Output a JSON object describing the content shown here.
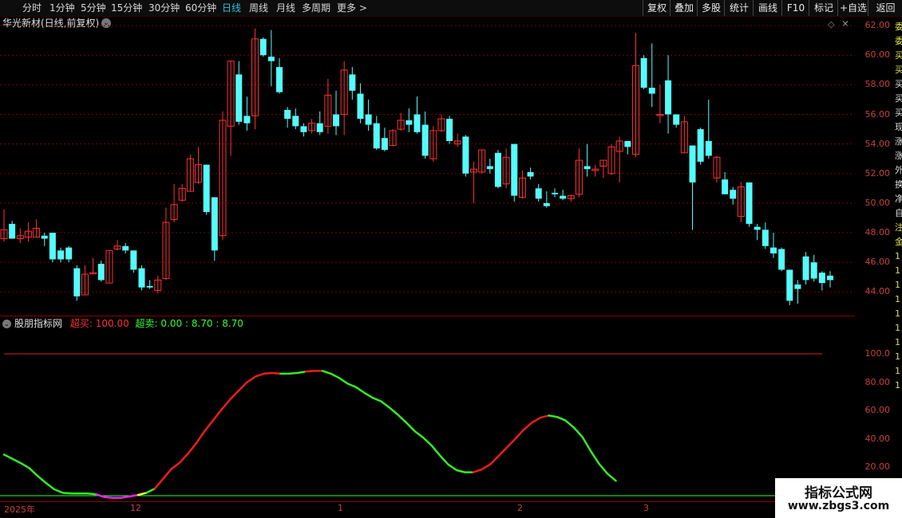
{
  "toolbar": {
    "periods": [
      "分时",
      "1分钟",
      "5分钟",
      "15分钟",
      "30分钟",
      "60分钟",
      "日线",
      "周线",
      "月线",
      "多周期",
      "更多 >"
    ],
    "active_period": "日线",
    "right_buttons": [
      "复权",
      "叠加",
      "多股",
      "统计",
      "画线",
      "F10",
      "标记",
      "+自选",
      "返回"
    ]
  },
  "stock": {
    "title": "华光新材(日线,前复权)"
  },
  "price_axis": {
    "ticks": [
      "62.00",
      "60.00",
      "58.00",
      "56.00",
      "54.00",
      "52.00",
      "50.00",
      "48.00",
      "46.00",
      "44.00"
    ],
    "min": 42.4,
    "max": 62.6
  },
  "indicator": {
    "name": "股朋指标网",
    "overbought_label": "超买:",
    "overbought_value": "100.00",
    "oversold_label": "超卖:",
    "oversold_values": "0.00 : 8.70 : 8.70",
    "axis_ticks": [
      "100.0",
      "80.00",
      "60.00",
      "40.00",
      "20.00"
    ],
    "line_level": 100,
    "low_line_level": 0
  },
  "date_axis": {
    "labels": [
      "2025年",
      "12",
      "1",
      "2",
      "3"
    ]
  },
  "right_strip": {
    "chars": [
      "委",
      "委",
      "买",
      "买",
      "买",
      "买",
      "买",
      "现",
      "涨",
      "涨",
      "外",
      "换",
      "净",
      "自",
      "注",
      "金",
      "1",
      "1",
      "1",
      "1",
      "1",
      "1",
      "1",
      "1",
      "1",
      "1"
    ]
  },
  "watermark": {
    "line1": "指标公式网",
    "line2": "www.zbgs3.com"
  },
  "colors": {
    "up": "#ff3232",
    "down": "#54fcfc",
    "grid": "#7a0000",
    "red_line": "#e02020",
    "green_line": "#30ff30"
  },
  "chart_data": {
    "type": "candlestick",
    "candles": [
      [
        47.6,
        49.6,
        48.2,
        47.4
      ],
      [
        48.6,
        48.8,
        47.6,
        47.6
      ],
      [
        47.6,
        48.3,
        47.8,
        47.3
      ],
      [
        47.7,
        48.7,
        48.1,
        47.4
      ],
      [
        47.7,
        48.9,
        48.3,
        47.7
      ],
      [
        47.8,
        48.0,
        47.6,
        47.1
      ],
      [
        48.0,
        48.0,
        46.2,
        46.0
      ],
      [
        46.8,
        47.0,
        46.2,
        46.0
      ],
      [
        47.0,
        47.1,
        46.2,
        46.0
      ],
      [
        45.6,
        45.8,
        43.7,
        43.4
      ],
      [
        43.8,
        45.8,
        45.2,
        43.8
      ],
      [
        45.3,
        46.3,
        45.3,
        45.2
      ],
      [
        45.9,
        46.1,
        44.8,
        44.7
      ],
      [
        44.6,
        46.8,
        46.8,
        44.6
      ],
      [
        46.9,
        47.5,
        47.1,
        46.8
      ],
      [
        47.1,
        47.3,
        46.8,
        46.6
      ],
      [
        46.8,
        46.8,
        45.5,
        45.3
      ],
      [
        45.6,
        45.8,
        44.3,
        44.1
      ],
      [
        44.4,
        44.8,
        44.3,
        44.2
      ],
      [
        44.1,
        45.1,
        44.8,
        43.9
      ],
      [
        44.9,
        49.7,
        48.7,
        44.8
      ],
      [
        48.9,
        51.3,
        49.9,
        48.7
      ],
      [
        50.2,
        51.3,
        51.0,
        50.1
      ],
      [
        50.8,
        53.3,
        53.0,
        50.8
      ],
      [
        51.4,
        53.8,
        52.6,
        51.3
      ],
      [
        52.6,
        52.6,
        49.4,
        49.2
      ],
      [
        50.4,
        50.4,
        46.8,
        46.1
      ],
      [
        47.8,
        56.2,
        55.6,
        47.5
      ],
      [
        55.2,
        59.6,
        59.6,
        53.2
      ],
      [
        58.7,
        59.6,
        55.5,
        55.3
      ],
      [
        55.9,
        57.2,
        55.4,
        54.9
      ],
      [
        55.9,
        61.8,
        61.1,
        55.0
      ],
      [
        61.1,
        61.2,
        60.0,
        59.9
      ],
      [
        59.9,
        61.7,
        59.6,
        57.9
      ],
      [
        59.2,
        59.8,
        57.5,
        57.4
      ],
      [
        56.3,
        56.5,
        55.7,
        55.1
      ],
      [
        55.9,
        56.4,
        55.2,
        55.0
      ],
      [
        55.2,
        55.4,
        54.8,
        54.5
      ],
      [
        54.9,
        55.7,
        55.4,
        54.7
      ],
      [
        55.4,
        56.2,
        54.8,
        54.6
      ],
      [
        55.2,
        58.4,
        57.3,
        54.7
      ],
      [
        56.0,
        57.6,
        55.2,
        54.6
      ],
      [
        56.0,
        59.6,
        59.0,
        54.6
      ],
      [
        58.7,
        59.2,
        57.6,
        57.0
      ],
      [
        57.4,
        58.1,
        55.7,
        55.4
      ],
      [
        56.0,
        57.0,
        55.3,
        54.9
      ],
      [
        55.4,
        55.9,
        53.7,
        53.6
      ],
      [
        54.4,
        55.1,
        53.6,
        53.5
      ],
      [
        53.9,
        55.0,
        54.9,
        53.9
      ],
      [
        55.0,
        56.1,
        55.6,
        54.9
      ],
      [
        55.6,
        56.4,
        55.3,
        54.8
      ],
      [
        56.0,
        57.2,
        54.8,
        54.7
      ],
      [
        55.3,
        56.2,
        53.2,
        53.0
      ],
      [
        53.0,
        55.2,
        54.9,
        52.8
      ],
      [
        54.9,
        56.0,
        55.7,
        54.8
      ],
      [
        55.7,
        55.9,
        54.2,
        54.0
      ],
      [
        54.0,
        54.7,
        54.2,
        53.8
      ],
      [
        54.5,
        54.6,
        52.0,
        51.8
      ],
      [
        52.1,
        52.8,
        52.3,
        50.0
      ],
      [
        52.1,
        53.5,
        53.6,
        52.0
      ],
      [
        52.5,
        53.0,
        52.3,
        52.0
      ],
      [
        53.4,
        53.6,
        51.1,
        51.0
      ],
      [
        51.3,
        53.7,
        53.1,
        51.0
      ],
      [
        54.0,
        54.0,
        50.5,
        50.1
      ],
      [
        50.4,
        52.2,
        51.7,
        50.3
      ],
      [
        52.1,
        52.4,
        51.8,
        51.6
      ],
      [
        51.0,
        51.3,
        50.3,
        50.1
      ],
      [
        50.0,
        50.8,
        49.8,
        49.7
      ],
      [
        50.7,
        51.0,
        50.6,
        50.4
      ],
      [
        50.5,
        50.9,
        50.3,
        50.2
      ],
      [
        50.3,
        50.6,
        50.5,
        50.1
      ],
      [
        50.6,
        53.7,
        52.9,
        50.4
      ],
      [
        52.5,
        54.0,
        52.3,
        51.8
      ],
      [
        52.2,
        52.6,
        52.3,
        51.8
      ],
      [
        52.5,
        52.5,
        52.9,
        51.7
      ],
      [
        52.0,
        54.0,
        53.8,
        51.9
      ],
      [
        53.5,
        54.5,
        54.2,
        51.4
      ],
      [
        54.2,
        53.5,
        53.8,
        53.3
      ],
      [
        53.3,
        61.5,
        59.3,
        53.1
      ],
      [
        59.8,
        60.0,
        57.8,
        57.7
      ],
      [
        57.8,
        60.8,
        57.4,
        56.5
      ],
      [
        56.0,
        58.0,
        56.0,
        55.4
      ],
      [
        58.3,
        60.0,
        56.0,
        54.7
      ],
      [
        56.0,
        55.9,
        55.3,
        55.1
      ],
      [
        53.4,
        55.9,
        55.5,
        54.1
      ],
      [
        53.9,
        53.9,
        51.4,
        48.2
      ],
      [
        55.0,
        55.1,
        52.8,
        52.6
      ],
      [
        54.2,
        57.0,
        53.2,
        53.0
      ],
      [
        51.7,
        53.2,
        53.1,
        51.4
      ],
      [
        51.6,
        52.1,
        50.6,
        50.6
      ],
      [
        50.9,
        51.1,
        50.3,
        49.9
      ],
      [
        49.1,
        51.4,
        51.1,
        48.7
      ],
      [
        51.4,
        51.4,
        48.6,
        48.4
      ],
      [
        48.4,
        48.6,
        48.2,
        47.5
      ],
      [
        48.2,
        48.7,
        47.1,
        46.9
      ],
      [
        47.0,
        48.0,
        46.6,
        46.3
      ],
      [
        46.9,
        47.0,
        45.5,
        45.4
      ],
      [
        45.5,
        45.5,
        43.4,
        43.1
      ],
      [
        44.5,
        44.8,
        44.2,
        43.2
      ],
      [
        46.4,
        46.7,
        44.8,
        44.5
      ],
      [
        46.0,
        46.5,
        44.9,
        44.7
      ],
      [
        45.3,
        45.4,
        44.6,
        44.1
      ],
      [
        45.1,
        45.4,
        44.8,
        44.3
      ]
    ],
    "indicator_segments": [
      {
        "color": "green",
        "values": [
          29,
          26,
          23,
          19.5,
          14,
          9,
          4.5,
          2,
          1.5,
          1.5,
          1.5,
          1
        ]
      },
      {
        "color": "magenta",
        "values": [
          1,
          -1,
          -1.5,
          -1.5,
          -0.5,
          0.5
        ]
      },
      {
        "color": "yellow",
        "values": [
          0.5,
          2
        ]
      },
      {
        "color": "green",
        "values": [
          2,
          5
        ]
      },
      {
        "color": "red",
        "values": [
          5,
          12,
          19,
          23.5,
          30,
          37.5,
          46,
          53.5,
          61,
          68,
          74,
          80,
          84,
          86,
          86.5,
          86
        ]
      },
      {
        "color": "green",
        "values": [
          86,
          86,
          86.5,
          87.5
        ]
      },
      {
        "color": "red",
        "values": [
          87.5,
          88,
          88
        ]
      },
      {
        "color": "green",
        "values": [
          88,
          86,
          83,
          79,
          76.5,
          72.5,
          69,
          66.5,
          62,
          57,
          51.5,
          45.5,
          41,
          35.5,
          28.5,
          22,
          18,
          16.5,
          16.5
        ]
      },
      {
        "color": "red",
        "values": [
          16.5,
          18.5,
          22,
          28,
          34,
          40,
          46.5,
          51.5,
          55,
          56.5
        ]
      },
      {
        "color": "green",
        "values": [
          56.5,
          55.5,
          53,
          48,
          41.5,
          31.5,
          22.5,
          15.5,
          10.5
        ]
      }
    ]
  }
}
